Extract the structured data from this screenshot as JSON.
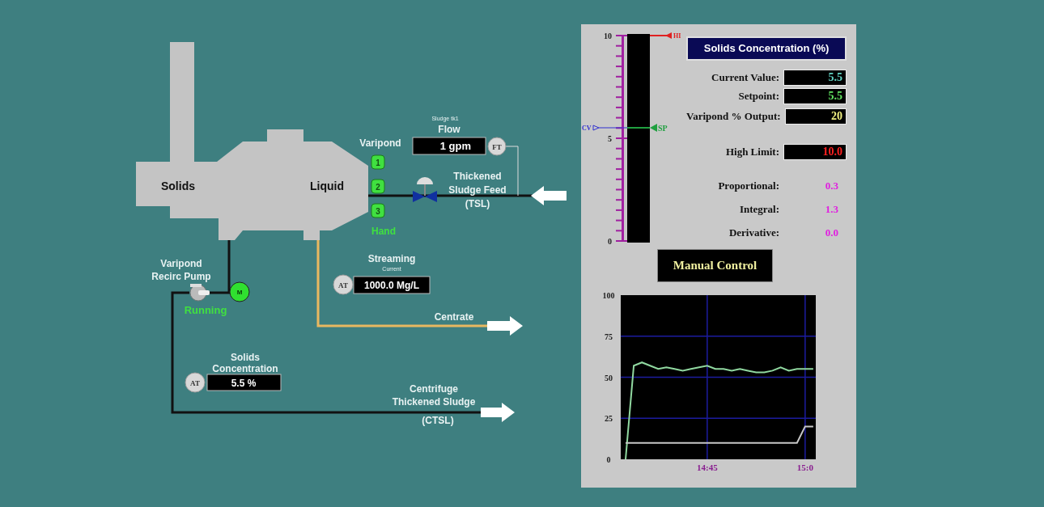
{
  "diagram": {
    "vessel_labels": [
      "Solids",
      "Liquid"
    ],
    "flow": {
      "caption": "Sludge tk1",
      "label": "Flow",
      "value": "1 gpm",
      "tag": "FT"
    },
    "valves": {
      "label": "Varipond",
      "buttons": [
        "1",
        "2",
        "3"
      ],
      "mode": "Hand"
    },
    "feed": {
      "lines": [
        "Thickened",
        "Sludge Feed",
        "(TSL)"
      ]
    },
    "streaming": {
      "label": "Streaming",
      "caption": "Current",
      "tag": "AT",
      "value": "1000.0  Mg/L"
    },
    "pump": {
      "lines": [
        "Varipond",
        "Recirc Pump"
      ],
      "status": "Running",
      "running": true,
      "mode": "M"
    },
    "centrate": "Centrate",
    "solids": {
      "lines": [
        "Solids",
        "Concentration"
      ],
      "tag": "AT",
      "value": "5.5 %"
    },
    "ctsl": {
      "lines": [
        "Centrifuge",
        "Thickened Sludge",
        "(CTSL)"
      ]
    }
  },
  "panel": {
    "gauge": {
      "ticks": [
        "10",
        "5",
        "0"
      ],
      "markers": [
        {
          "kind": "limit",
          "label": "HI",
          "level": 1.0,
          "color": "#e02020"
        },
        {
          "kind": "value",
          "label": "CV",
          "level": 0.55,
          "color": "#3030d0"
        },
        {
          "kind": "setpoint",
          "label": "SP",
          "level": 0.55,
          "color": "#20a040"
        }
      ]
    },
    "title": "Solids Concentration (%)",
    "readouts": [
      {
        "kind": "current",
        "label": "Current Value:",
        "value": "5.5"
      },
      {
        "kind": "setpoint",
        "label": "Setpoint:",
        "value": "5.5"
      },
      {
        "kind": "output",
        "label": "Varipond % Output:",
        "value": "20"
      },
      {
        "kind": "limit",
        "label": "High Limit:",
        "value": "10.0"
      }
    ],
    "tuning": [
      {
        "label": "Proportional:",
        "value": "0.3"
      },
      {
        "label": "Integral:",
        "value": "1.3"
      },
      {
        "label": "Derivative:",
        "value": "0.0"
      }
    ],
    "mode_button": "Manual Control",
    "trend": {
      "chart_data": {
        "type": "line",
        "categories": [
          null,
          null,
          null,
          null,
          null,
          null,
          null,
          null,
          null,
          null,
          "14:45",
          null,
          null,
          null,
          null,
          null,
          null,
          null,
          null,
          null,
          null,
          null,
          "15:0",
          null
        ],
        "series": [
          {
            "color": "#90d8a0",
            "values": [
              0,
              57,
              59,
              57,
              55,
              56,
              55,
              54,
              55,
              56,
              57,
              55,
              55,
              54,
              55,
              54,
              53,
              53,
              54,
              56,
              54,
              55,
              55,
              55
            ]
          },
          {
            "color": "#c8c8c8",
            "values": [
              10,
              10,
              10,
              10,
              10,
              10,
              10,
              10,
              10,
              10,
              10,
              10,
              10,
              10,
              10,
              10,
              10,
              10,
              10,
              10,
              10,
              10,
              20,
              20
            ]
          }
        ],
        "grid": true,
        "ylim": [
          0,
          100
        ],
        "yticks": [
          0,
          25,
          50,
          75,
          100
        ]
      }
    }
  }
}
